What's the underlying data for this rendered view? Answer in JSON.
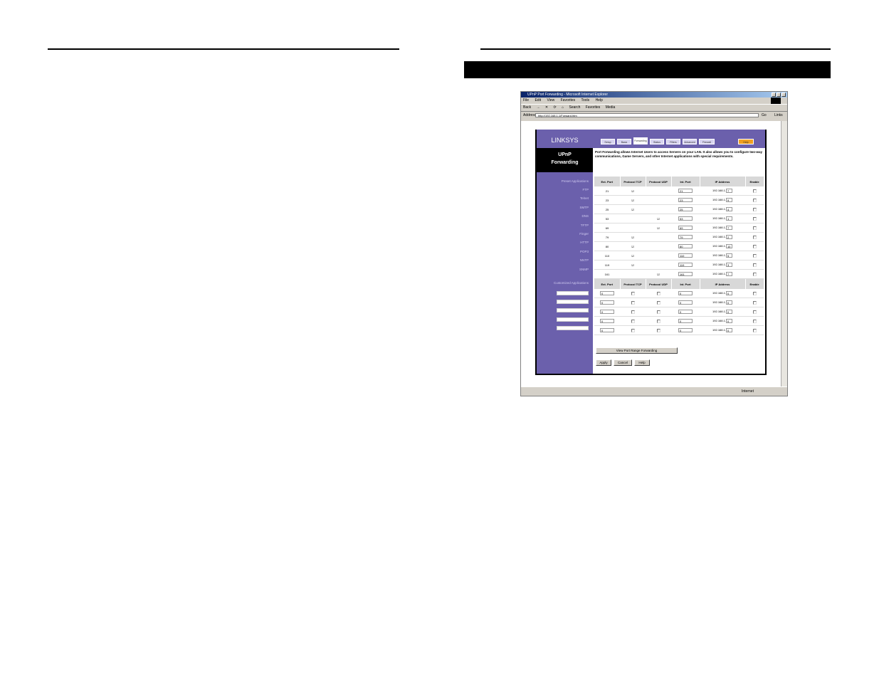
{
  "browser": {
    "title": "UPnP Port Forwarding - Microsoft Internet Explorer",
    "menu": [
      "File",
      "Edit",
      "View",
      "Favorites",
      "Tools",
      "Help"
    ],
    "toolbar": [
      "Back",
      "→",
      "✕",
      "⟳",
      "⌂",
      "Search",
      "Favorites",
      "Media"
    ],
    "address_label": "Address",
    "url": "http://192.168.1.1/Forward.htm",
    "go": "Go",
    "links": "Links",
    "status_zone": "Internet"
  },
  "router": {
    "brand": "LINKSYS",
    "section_title_line1": "UPnP",
    "section_title_line2": "Forwarding",
    "tabs": [
      "Setup",
      "Basic",
      "Forwarding",
      "Status",
      "Filters",
      "Advanced",
      "Firewall",
      "Help"
    ],
    "description": "Port Forwarding allows Internet Users to access Servers on your LAN. It also allows you to configure two-way communications, Game Servers, and other Internet applications with special requirements.",
    "preset_label": "Preset Applications",
    "custom_label": "Customized Applications",
    "headers": [
      "Ext. Port",
      "Protocol TCP",
      "Protocol UDP",
      "Int. Port",
      "IP Address",
      "Enable"
    ],
    "ip_prefix": "192.168.1.",
    "preset_rows": [
      {
        "app": "FTP",
        "ext": "21",
        "tcp": "☑",
        "udp": "",
        "int": "21",
        "ip": "7",
        "enable": ""
      },
      {
        "app": "Telnet",
        "ext": "23",
        "tcp": "☑",
        "udp": "",
        "int": "23",
        "ip": "9",
        "enable": ""
      },
      {
        "app": "SMTP",
        "ext": "25",
        "tcp": "☑",
        "udp": "",
        "int": "25",
        "ip": "4",
        "enable": ""
      },
      {
        "app": "DNS",
        "ext": "53",
        "tcp": "",
        "udp": "☑",
        "int": "53",
        "ip": "1",
        "enable": ""
      },
      {
        "app": "TFTP",
        "ext": "69",
        "tcp": "",
        "udp": "☑",
        "int": "69",
        "ip": "7",
        "enable": ""
      },
      {
        "app": "Finger",
        "ext": "79",
        "tcp": "☑",
        "udp": "",
        "int": "79",
        "ip": "2",
        "enable": ""
      },
      {
        "app": "HTTP",
        "ext": "80",
        "tcp": "☑",
        "udp": "",
        "int": "80",
        "ip": "10",
        "enable": ""
      },
      {
        "app": "POP3",
        "ext": "110",
        "tcp": "☑",
        "udp": "",
        "int": "110",
        "ip": "5",
        "enable": ""
      },
      {
        "app": "NNTP",
        "ext": "119",
        "tcp": "☑",
        "udp": "",
        "int": "119",
        "ip": "3",
        "enable": ""
      },
      {
        "app": "SNMP",
        "ext": "161",
        "tcp": "",
        "udp": "☑",
        "int": "161",
        "ip": "7",
        "enable": ""
      }
    ],
    "custom_rows": [
      {
        "ext": "0",
        "int": "0",
        "ip": "0"
      },
      {
        "ext": "0",
        "int": "0",
        "ip": "0"
      },
      {
        "ext": "0",
        "int": "0",
        "ip": "0"
      },
      {
        "ext": "0",
        "int": "0",
        "ip": "0"
      },
      {
        "ext": "0",
        "int": "0",
        "ip": "0"
      }
    ],
    "view_range_button": "View Port Range Forwarding",
    "apply": "Apply",
    "cancel": "Cancel",
    "help": "Help"
  }
}
